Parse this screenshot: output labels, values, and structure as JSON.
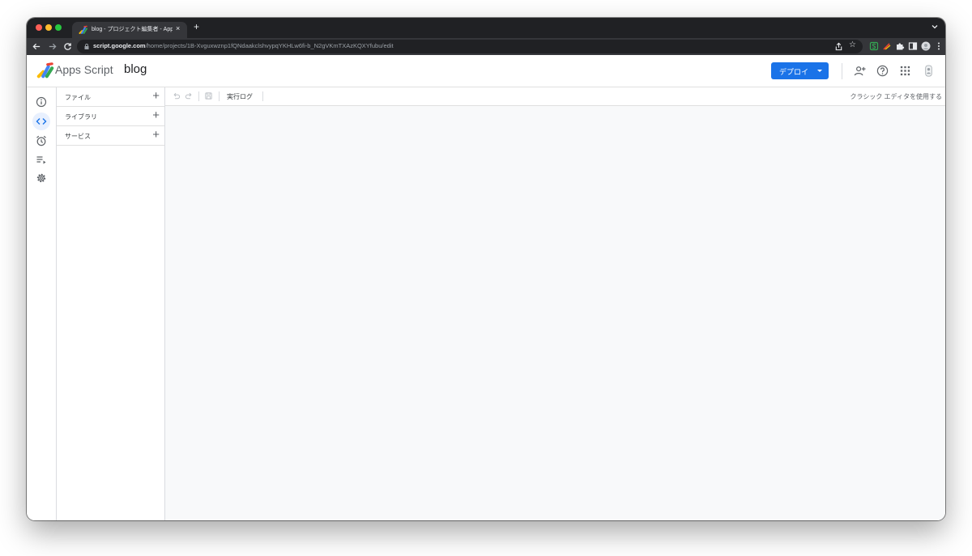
{
  "browser": {
    "tab_title": "blog - プロジェクト編集者 - Apps Script",
    "tab_close": "×",
    "new_tab": "+",
    "url_host": "script.google.com",
    "url_path": "/home/projects/1B-Xvguxwznp1fQNdaakclshvypqYKHLw6fi-b_N2gVKmTXAzKQXYfubu/edit",
    "star": "☆"
  },
  "header": {
    "app_name": "Apps Script",
    "project_name": "blog",
    "deploy_label": "デプロイ",
    "accent_color": "#1a73e8"
  },
  "rail": {
    "items": [
      {
        "name": "overview",
        "icon": "info-icon",
        "active": false
      },
      {
        "name": "editor",
        "icon": "code-icon",
        "active": true
      },
      {
        "name": "triggers",
        "icon": "alarm-clock-icon",
        "active": false
      },
      {
        "name": "executions",
        "icon": "executions-list-icon",
        "active": false
      },
      {
        "name": "settings",
        "icon": "gear-icon",
        "active": false
      }
    ]
  },
  "panel": {
    "items": [
      {
        "label": "ファイル",
        "add": "+"
      },
      {
        "label": "ライブラリ",
        "add": "+"
      },
      {
        "label": "サービス",
        "add": "+"
      }
    ]
  },
  "toolbar": {
    "log_label": "実行ログ",
    "classic_link": "クラシック エディタを使用する"
  }
}
